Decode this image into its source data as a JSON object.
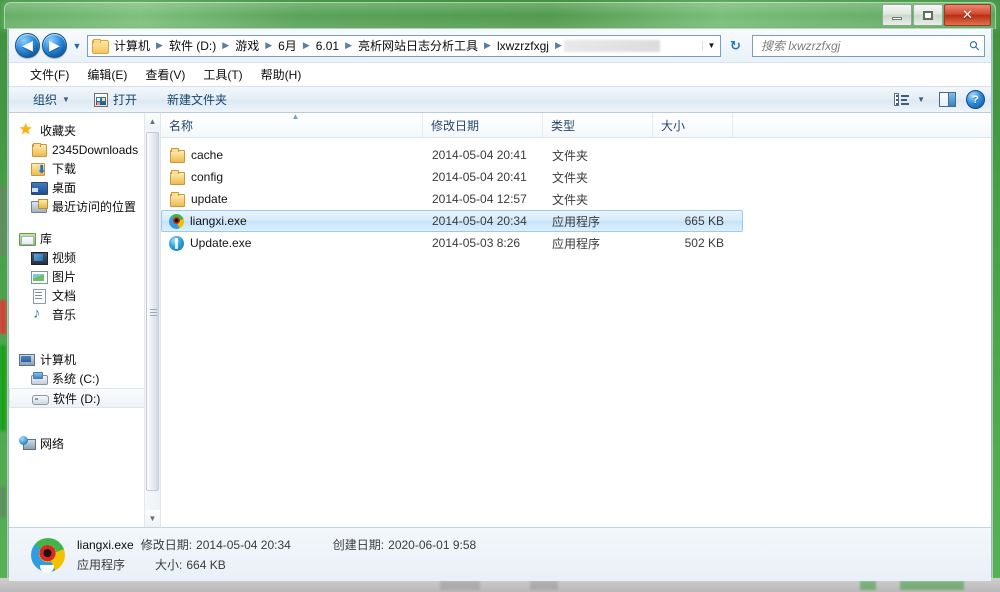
{
  "window": {
    "minimize_label": "—",
    "maximize_label": "❐",
    "close_label": "✕"
  },
  "addressbar": {
    "back_label": "◀",
    "forward_label": "▶",
    "history_caret": "▼",
    "breadcrumbs": [
      "计算机",
      "软件 (D:)",
      "游戏",
      "6月",
      "6.01",
      "亮析网站日志分析工具",
      "lxwzrzfxgj"
    ],
    "separator": "▶",
    "dropdown_caret": "▼",
    "refresh_label": "↻",
    "search_placeholder": "搜索 lxwzrzfxgj",
    "search_icon": "⚲"
  },
  "menubar": {
    "items": [
      "文件(F)",
      "编辑(E)",
      "查看(V)",
      "工具(T)",
      "帮助(H)"
    ]
  },
  "toolbar": {
    "organize_label": "组织",
    "organize_caret": "▼",
    "open_label": "打开",
    "new_folder_label": "新建文件夹",
    "view_caret": "▼",
    "help_label": "?"
  },
  "sidebar": {
    "groups": [
      {
        "header": "收藏夹",
        "header_icon": "star-icon",
        "items": [
          {
            "label": "2345Downloads",
            "icon": "folder-icon"
          },
          {
            "label": "下载",
            "icon": "download-folder-icon"
          },
          {
            "label": "桌面",
            "icon": "desktop-icon"
          },
          {
            "label": "最近访问的位置",
            "icon": "recent-places-icon"
          }
        ]
      },
      {
        "header": "库",
        "header_icon": "library-icon",
        "items": [
          {
            "label": "视频",
            "icon": "video-icon"
          },
          {
            "label": "图片",
            "icon": "picture-icon"
          },
          {
            "label": "文档",
            "icon": "document-icon"
          },
          {
            "label": "音乐",
            "icon": "music-icon"
          }
        ]
      },
      {
        "header": "计算机",
        "header_icon": "computer-icon",
        "items": [
          {
            "label": "系统 (C:)",
            "icon": "hard-disk-icon",
            "selected": false
          },
          {
            "label": "软件 (D:)",
            "icon": "hard-disk-icon",
            "selected": true
          }
        ]
      },
      {
        "header": "网络",
        "header_icon": "network-icon",
        "items": []
      }
    ],
    "scroll_up": "▲",
    "scroll_down": "▼"
  },
  "filelist": {
    "columns": [
      "名称",
      "修改日期",
      "类型",
      "大小"
    ],
    "sort_indicator": "▲",
    "rows": [
      {
        "name": "cache",
        "date": "2014-05-04 20:41",
        "type": "文件夹",
        "size": "",
        "icon": "folder-icon",
        "selected": false
      },
      {
        "name": "config",
        "date": "2014-05-04 20:41",
        "type": "文件夹",
        "size": "",
        "icon": "folder-icon",
        "selected": false
      },
      {
        "name": "update",
        "date": "2014-05-04 12:57",
        "type": "文件夹",
        "size": "",
        "icon": "folder-icon",
        "selected": false
      },
      {
        "name": "liangxi.exe",
        "date": "2014-05-04 20:34",
        "type": "应用程序",
        "size": "665 KB",
        "icon": "liangxi-app-icon",
        "selected": true
      },
      {
        "name": "Update.exe",
        "date": "2014-05-03 8:26",
        "type": "应用程序",
        "size": "502 KB",
        "icon": "update-app-icon",
        "selected": false
      }
    ]
  },
  "details": {
    "file_name": "liangxi.exe",
    "modified_label": "修改日期:",
    "modified_value": "2014-05-04 20:34",
    "created_label": "创建日期:",
    "created_value": "2020-06-01 9:58",
    "type_value": "应用程序",
    "size_label": "大小:",
    "size_value": "664 KB",
    "icon": "liangxi-app-icon"
  },
  "colors": {
    "title_bar_green": "#4aa04a",
    "selection_blue": "#c6e2fa",
    "selection_border": "#9ccbf0",
    "close_button_red": "#d1492e",
    "link_blue": "#13456e"
  }
}
